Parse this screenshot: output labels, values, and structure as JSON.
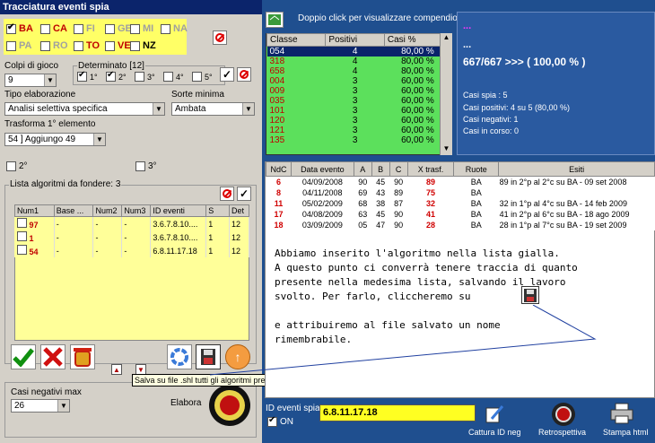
{
  "title": "Tracciatura eventi spia",
  "wheels": [
    {
      "label": "BA",
      "checked": true,
      "color": "#c00000"
    },
    {
      "label": "CA",
      "checked": false,
      "color": "#c00000"
    },
    {
      "label": "FI",
      "checked": false,
      "color": "#a0a0a0"
    },
    {
      "label": "GE",
      "checked": false,
      "color": "#a0a0a0"
    },
    {
      "label": "MI",
      "checked": false,
      "color": "#a0a0a0"
    },
    {
      "label": "NA",
      "checked": false,
      "color": "#a0a0a0"
    },
    {
      "label": "PA",
      "checked": false,
      "color": "#a0a0a0"
    },
    {
      "label": "RO",
      "checked": false,
      "color": "#a0a0a0"
    },
    {
      "label": "TO",
      "checked": false,
      "color": "#c00000"
    },
    {
      "label": "VE",
      "checked": false,
      "color": "#c00000"
    },
    {
      "label": "NZ",
      "checked": false,
      "color": "#000000"
    }
  ],
  "colpi": {
    "label": "Colpi di gioco",
    "value": "9"
  },
  "determinato": {
    "label": "Determinato [12]",
    "items": [
      "1°",
      "2°",
      "3°",
      "4°",
      "5°"
    ],
    "checked": [
      true,
      true,
      false,
      false,
      false
    ]
  },
  "tipo": {
    "label": "Tipo elaborazione",
    "value": "Analisi selettiva specifica"
  },
  "sorte": {
    "label": "Sorte minima",
    "value": "Ambata"
  },
  "trasforma": {
    "label": "Trasforma 1° elemento",
    "value": "54 ] Aggiungo 49"
  },
  "pos2": "2°",
  "pos3": "3°",
  "lista": {
    "label": "Lista algoritmi da fondere: 3",
    "headers": [
      "Num1",
      "Base ...",
      "Num2",
      "Num3",
      "ID eventi",
      "S",
      "Det"
    ],
    "rows": [
      [
        "97",
        "-",
        "-",
        "-",
        "3.6.7.8.10....",
        "1",
        "12"
      ],
      [
        "1",
        "-",
        "-",
        "-",
        "3.6.7.8.10....",
        "1",
        "12"
      ],
      [
        "54",
        "-",
        "-",
        "-",
        "6.8.11.17.18",
        "1",
        "12"
      ]
    ]
  },
  "tooltip": "Salva su file .shl tutti gli algoritmi presenti nella lista",
  "negativi": {
    "label": "Casi negativi max",
    "value": "26"
  },
  "elabora": "Elabora",
  "compendio": "Doppio click per visualizzare compendio",
  "classi": {
    "headers": [
      "Classe",
      "Positivi",
      "Casi %"
    ],
    "rows": [
      [
        "054",
        "4",
        "80,00 %"
      ],
      [
        "318",
        "4",
        "80,00 %"
      ],
      [
        "658",
        "4",
        "80,00 %"
      ],
      [
        "004",
        "3",
        "60,00 %"
      ],
      [
        "009",
        "3",
        "60,00 %"
      ],
      [
        "035",
        "3",
        "60,00 %"
      ],
      [
        "101",
        "3",
        "60,00 %"
      ],
      [
        "120",
        "3",
        "60,00 %"
      ],
      [
        "121",
        "3",
        "60,00 %"
      ],
      [
        "135",
        "3",
        "60,00 %"
      ]
    ]
  },
  "info": {
    "dots1": "...",
    "dots2": "...",
    "result": "667/667 >>> ( 100,00 % )",
    "spia": "Casi spia : 5",
    "positivi": "Casi positivi: 4 su 5 (80,00 %)",
    "negativi": "Casi negativi: 1",
    "corso": "Casi in corso: 0"
  },
  "eventi": {
    "headers": [
      "NdC",
      "Data evento",
      "A",
      "B",
      "C",
      "X trasf.",
      "Ruote",
      "Esiti"
    ],
    "rows": [
      [
        "6",
        "04/09/2008",
        "90",
        "45",
        "90",
        "89",
        "BA",
        "89 in 2°p al 2°c su BA - 09 set 2008"
      ],
      [
        "8",
        "04/11/2008",
        "69",
        "43",
        "89",
        "75",
        "BA",
        ""
      ],
      [
        "11",
        "05/02/2009",
        "68",
        "38",
        "87",
        "32",
        "BA",
        "32 in 1°p al 4°c su BA - 14 feb 2009"
      ],
      [
        "17",
        "04/08/2009",
        "63",
        "45",
        "90",
        "41",
        "BA",
        "41 in 2°p al 6°c su BA - 18 ago 2009"
      ],
      [
        "18",
        "03/09/2009",
        "05",
        "47",
        "90",
        "28",
        "BA",
        "28 in 1°p al 7°c su BA - 19 set 2009"
      ]
    ]
  },
  "note": "Abbiamo inserito l'algoritmo nella lista gialla.\nA questo punto ci converrà tenere traccia di quanto\npresente nella medesima lista, salvando il lavoro\nsvolto. Per farlo, cliccheremo su\n\ne attribuiremo al file salvato un nome\nrimembrabile.",
  "idspia": {
    "label": "ID eventi spia",
    "value": "6.8.11.17.18",
    "on": "ON"
  },
  "buttons": {
    "cattura": "Cattura ID neg",
    "retro": "Retrospettiva",
    "stampa": "Stampa html"
  }
}
